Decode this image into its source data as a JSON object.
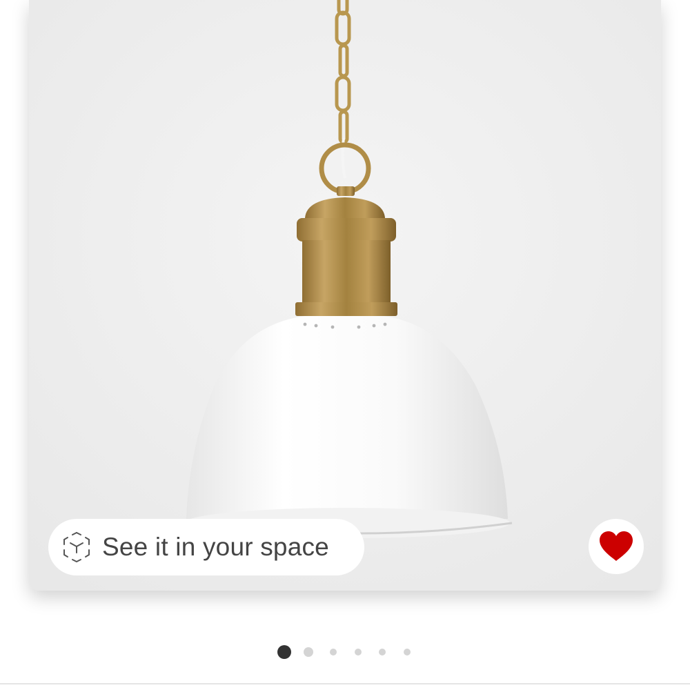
{
  "product": {
    "image_alt": "White and brass dome pendant light hanging from brass chain"
  },
  "ar_button": {
    "label": "See it in your space",
    "icon": "ar-cube-icon"
  },
  "favorite_button": {
    "icon": "heart-icon",
    "state": "favorited",
    "color": "#cc0000"
  },
  "carousel": {
    "total_images": 6,
    "current_index": 0,
    "active_dot_color": "#333333",
    "inactive_dot_color": "#d4d4d4"
  }
}
